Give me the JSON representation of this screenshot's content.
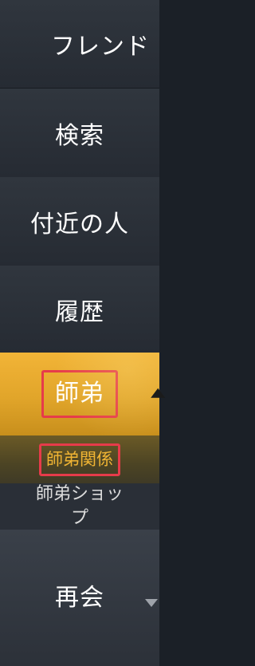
{
  "menu": {
    "items": [
      {
        "label": "フレンド"
      },
      {
        "label": "検索"
      },
      {
        "label": "付近の人"
      },
      {
        "label": "履歴"
      },
      {
        "label": "師弟"
      }
    ],
    "submenu": [
      {
        "label": "師弟関係"
      },
      {
        "label": "師弟ショップ"
      }
    ],
    "reunion": {
      "label": "再会"
    }
  },
  "colors": {
    "active_bg": "#e8ac30",
    "active_sub_text": "#f0b433",
    "highlight_box": "#e63b4a"
  }
}
